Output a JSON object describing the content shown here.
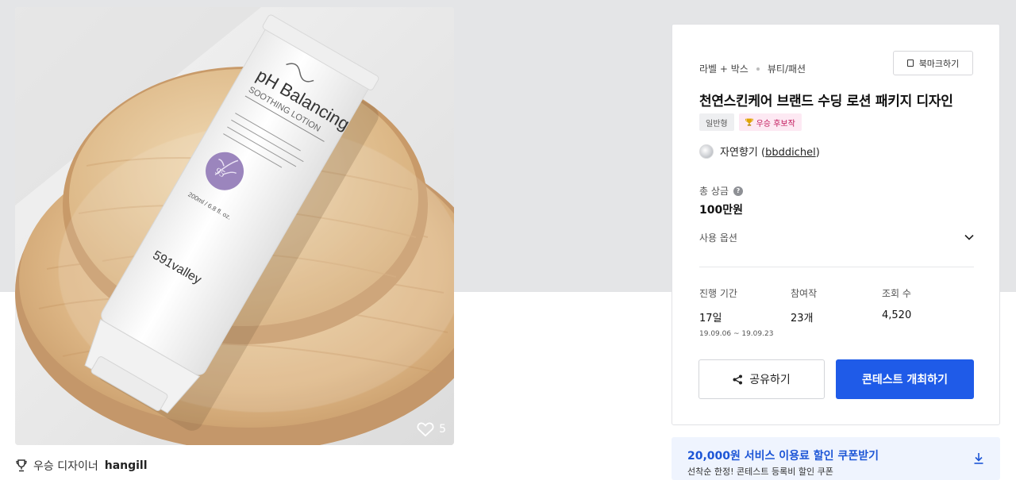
{
  "contest": {
    "category_main": "라벨 + 박스",
    "category_sub": "뷰티/패션",
    "bookmark_label": "북마크하기",
    "title": "천연스킨케어 브랜드 수딩 로션 패키지 디자인",
    "tag_type": "일반형",
    "tag_status": "우승 후보작",
    "owner_name": "자연향기",
    "owner_id": "bbddichel",
    "prize_label": "총 상금",
    "prize_value": "100만원",
    "options_label": "사용 옵션",
    "stats": [
      {
        "label": "진행 기간",
        "value": "17일",
        "sub": "19.09.06 ~ 19.09.23"
      },
      {
        "label": "참여작",
        "value": "23개"
      },
      {
        "label": "조회 수",
        "value": "4,520"
      }
    ],
    "share_label": "공유하기",
    "host_label": "콘테스트 개최하기"
  },
  "image": {
    "likes": "5",
    "product_brand": "pH Balancing",
    "product_line": "SOOTHING LOTION",
    "product_maker": "591valley",
    "product_volume": "200ml / 6.8 fl. oz.",
    "product_badge": "95"
  },
  "winner": {
    "prefix": "우승 디자이너",
    "name": "hangill"
  },
  "coupon": {
    "main": "20,000원 서비스 이용료 할인 쿠폰받기",
    "sub": "선착순 한정! 콘테스트 등록비 할인 쿠폰"
  },
  "colors": {
    "primary": "#1f5be8",
    "coupon_bg": "#eff4fe",
    "coupon_text": "#1c55d6",
    "tag_pink_bg": "#fde9f3",
    "tag_pink_text": "#c2185b"
  }
}
